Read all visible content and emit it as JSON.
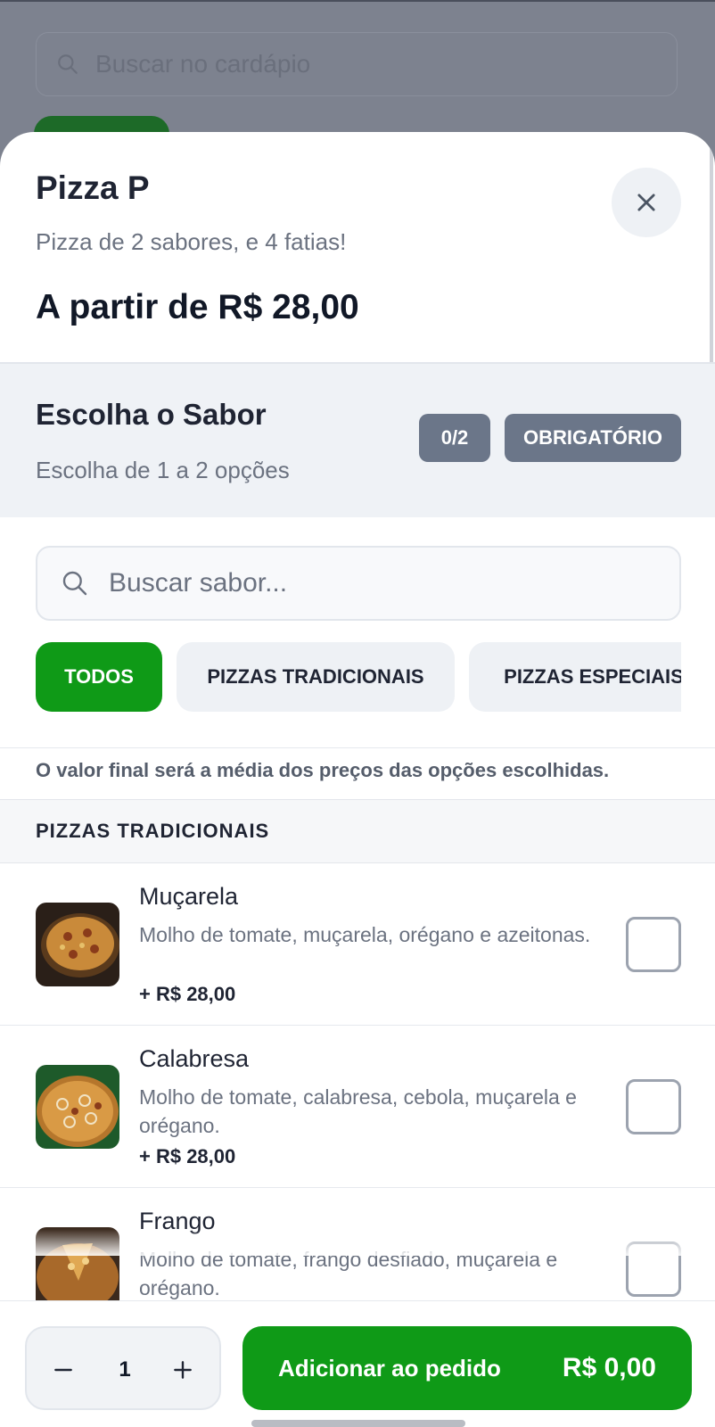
{
  "background": {
    "search_placeholder": "Buscar no cardápio"
  },
  "modal": {
    "title": "Pizza P",
    "subtitle": "Pizza de 2 sabores, e 4 fatias!",
    "price_from": "A partir de R$ 28,00"
  },
  "section": {
    "title": "Escolha o Sabor",
    "subtitle": "Escolha de 1 a 2 opções",
    "count_badge": "0/2",
    "required_badge": "OBRIGATÓRIO"
  },
  "search": {
    "placeholder": "Buscar sabor..."
  },
  "chips": [
    {
      "label": "TODOS"
    },
    {
      "label": "PIZZAS TRADICIONAIS"
    },
    {
      "label": "PIZZAS ESPECIAIS"
    }
  ],
  "note": "O valor final será a média dos preços das opções escolhidas.",
  "group": {
    "title": "PIZZAS TRADICIONAIS",
    "items": [
      {
        "name": "Muçarela",
        "desc": "Molho de tomate, muçarela, orégano e azeitonas.",
        "price": "+ R$ 28,00"
      },
      {
        "name": "Calabresa",
        "desc": "Molho de tomate, calabresa, cebola, muçarela e orégano.",
        "price": "+ R$ 28,00"
      },
      {
        "name": "Frango",
        "desc": "Molho de tomate, frango desfiado, muçarela e orégano.",
        "price": ""
      }
    ]
  },
  "footer": {
    "quantity": "1",
    "add_label": "Adicionar ao pedido",
    "total": "R$ 0,00"
  },
  "colors": {
    "primary_green": "#0f9a17",
    "badge_gray": "#6b7689",
    "text_dark": "#1f2433"
  }
}
